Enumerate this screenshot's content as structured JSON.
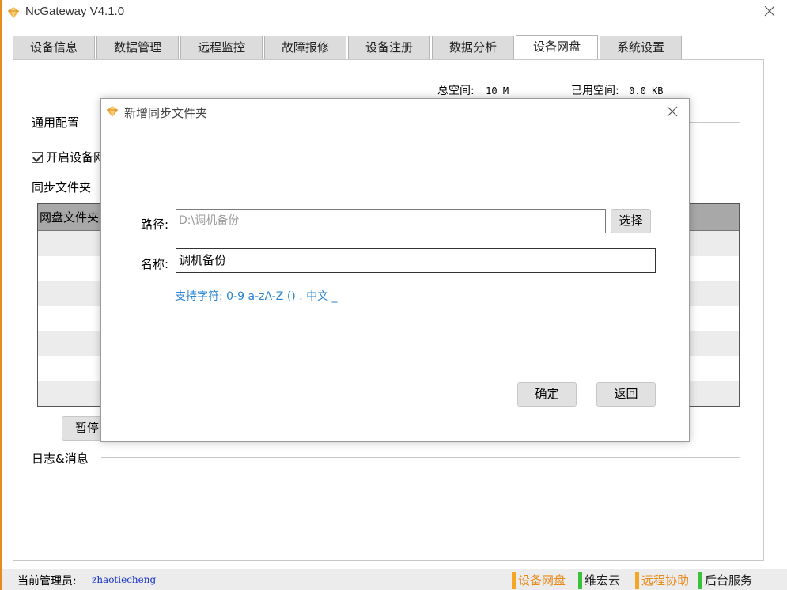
{
  "window": {
    "title": "NcGateway V4.1.0",
    "close_icon": "close-icon",
    "app_icon": "gem-logo-icon"
  },
  "tabs": [
    {
      "label": "设备信息",
      "active": false
    },
    {
      "label": "数据管理",
      "active": false
    },
    {
      "label": "远程监控",
      "active": false
    },
    {
      "label": "故障报修",
      "active": false
    },
    {
      "label": "设备注册",
      "active": false
    },
    {
      "label": "数据分析",
      "active": false
    },
    {
      "label": "设备网盘",
      "active": true
    },
    {
      "label": "系统设置",
      "active": false
    }
  ],
  "storage": {
    "total_label": "总空间:",
    "total_value": "10 M",
    "used_label": "已用空间:",
    "used_value": "0.0 KB"
  },
  "config": {
    "section_title": "通用配置",
    "enable_checkbox_label": "开启设备网",
    "enable_checked": true
  },
  "sync": {
    "section_title": "同步文件夹",
    "table_header": "网盘文件夹",
    "pause_button_label": "暂停同"
  },
  "log": {
    "section_title": "日志&消息"
  },
  "status_bar": {
    "admin_label": "当前管理员:",
    "admin_name": "zhaotiecheng",
    "buttons": [
      {
        "label": "设备网盘",
        "color": "#f5a623",
        "text_color": "#e88a1a"
      },
      {
        "label": "维宏云",
        "color": "#3cc13b",
        "text_color": "#222222"
      },
      {
        "label": "远程协助",
        "color": "#f5a623",
        "text_color": "#e88a1a"
      },
      {
        "label": "后台服务",
        "color": "#3cc13b",
        "text_color": "#222222"
      }
    ]
  },
  "dialog": {
    "title": "新增同步文件夹",
    "path_label": "路径:",
    "path_value": "D:\\调机备份",
    "choose_button": "选择",
    "name_label": "名称:",
    "name_value": "调机备份",
    "hint": "支持字符: 0-9 a-zA-Z () . 中文 _",
    "ok_button": "确定",
    "back_button": "返回",
    "hint_color": "#2a84d2"
  }
}
